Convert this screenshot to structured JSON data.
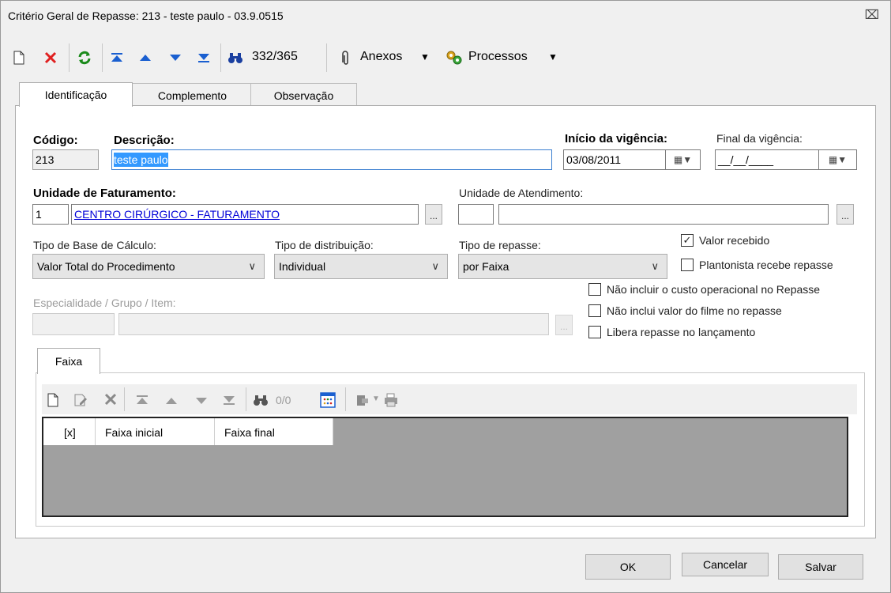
{
  "window": {
    "title": "Critério Geral de Repasse: 213 - teste paulo - 03.9.0515",
    "close_icon": "close-icon"
  },
  "toolbar": {
    "record_position": "332/365",
    "anexos_label": "Anexos",
    "processos_label": "Processos"
  },
  "tabs": [
    {
      "label": "Identificação",
      "active": true
    },
    {
      "label": "Complemento",
      "active": false
    },
    {
      "label": "Observação",
      "active": false
    }
  ],
  "form": {
    "codigo": {
      "label": "Código:",
      "value": "213"
    },
    "descricao": {
      "label": "Descrição:",
      "value": "teste paulo"
    },
    "inicio_vigencia": {
      "label": "Início da vigência:",
      "value": "03/08/2011"
    },
    "final_vigencia": {
      "label": "Final da vigência:",
      "value": "__/__/____"
    },
    "unidade_faturamento": {
      "label": "Unidade de Faturamento:",
      "code": "1",
      "name": "CENTRO CIRÚRGICO - FATURAMENTO"
    },
    "unidade_atendimento": {
      "label": "Unidade de Atendimento:",
      "code": "",
      "name": ""
    },
    "tipo_base_calculo": {
      "label": "Tipo de Base de Cálculo:",
      "value": "Valor Total do Procedimento"
    },
    "tipo_distribuicao": {
      "label": "Tipo de distribuição:",
      "value": "Individual"
    },
    "tipo_repasse": {
      "label": "Tipo de repasse:",
      "value": "por Faixa"
    },
    "especialidade": {
      "label": "Especialidade / Grupo / Item:"
    },
    "dots_label": "...",
    "checkboxes": [
      {
        "label": "Valor recebido",
        "checked": true
      },
      {
        "label": "Plantonista recebe repasse",
        "checked": false
      },
      {
        "label": "Não incluir o custo operacional no Repasse",
        "checked": false
      },
      {
        "label": "Não inclui valor do filme no repasse",
        "checked": false
      },
      {
        "label": "Libera repasse no lançamento",
        "checked": false
      }
    ]
  },
  "faixa": {
    "tab_label": "Faixa",
    "record_count": "0/0",
    "columns": [
      "[x]",
      "Faixa inicial",
      "Faixa final"
    ]
  },
  "buttons": {
    "ok": "OK",
    "cancelar": "Cancelar",
    "salvar": "Salvar"
  }
}
